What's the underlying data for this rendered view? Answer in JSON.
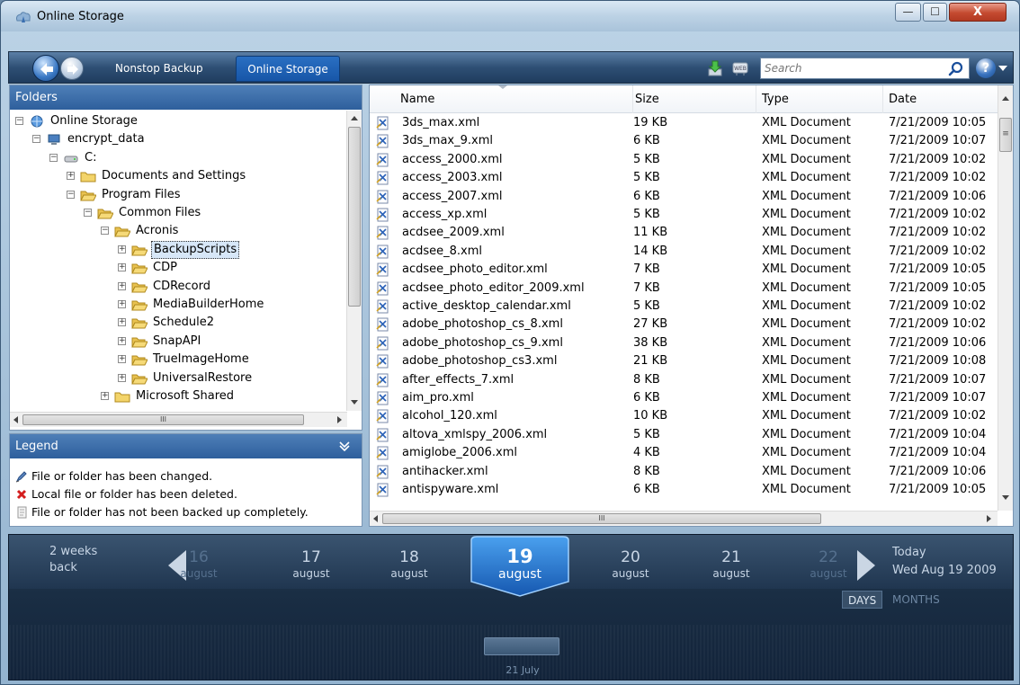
{
  "window": {
    "title": "Online Storage",
    "min_glyph": "—",
    "max_glyph": "☐",
    "close_glyph": "X"
  },
  "toolbar": {
    "tabs": [
      {
        "label": "Nonstop Backup"
      },
      {
        "label": "Online Storage"
      }
    ],
    "active_tab": "Online Storage",
    "search_placeholder": "Search",
    "help_glyph": "?"
  },
  "folders": {
    "title": "Folders",
    "tree": [
      {
        "label": "Online Storage",
        "expander": "−",
        "icon": "globe-icon"
      },
      {
        "label": "encrypt_data",
        "expander": "−",
        "icon": "computer-icon"
      },
      {
        "label": "C:",
        "expander": "−",
        "icon": "drive-icon"
      },
      {
        "label": "Documents and Settings",
        "expander": "+",
        "icon": "folder-icon"
      },
      {
        "label": "Program Files",
        "expander": "−",
        "icon": "open-folder-icon"
      },
      {
        "label": "Common Files",
        "expander": "−",
        "icon": "open-folder-icon"
      },
      {
        "label": "Acronis",
        "expander": "−",
        "icon": "open-folder-icon"
      },
      {
        "label": "BackupScripts",
        "expander": "+",
        "icon": "open-folder-icon",
        "selected": true
      },
      {
        "label": "CDP",
        "expander": "+",
        "icon": "open-folder-icon"
      },
      {
        "label": "CDRecord",
        "expander": "+",
        "icon": "open-folder-icon"
      },
      {
        "label": "MediaBuilderHome",
        "expander": "+",
        "icon": "open-folder-icon"
      },
      {
        "label": "Schedule2",
        "expander": "+",
        "icon": "open-folder-icon"
      },
      {
        "label": "SnapAPI",
        "expander": "+",
        "icon": "open-folder-icon"
      },
      {
        "label": "TrueImageHome",
        "expander": "+",
        "icon": "open-folder-icon"
      },
      {
        "label": "UniversalRestore",
        "expander": "+",
        "icon": "open-folder-icon"
      },
      {
        "label": "Microsoft Shared",
        "expander": "+",
        "icon": "folder-icon"
      }
    ],
    "hscroll_grip": "III"
  },
  "legend": {
    "title": "Legend",
    "items": [
      {
        "label": "File or folder has been changed.",
        "icon": "changed-file-icon"
      },
      {
        "label": "Local file or folder has been deleted.",
        "icon": "deleted-file-icon"
      },
      {
        "label": "File or folder has not been backed up completely.",
        "icon": "incomplete-file-icon"
      }
    ]
  },
  "files": {
    "columns": [
      "Name",
      "Size",
      "Type",
      "Date"
    ],
    "rows": [
      {
        "name": "3ds_max.xml",
        "size": "19 KB",
        "type": "XML Document",
        "date": "7/21/2009 10:05"
      },
      {
        "name": "3ds_max_9.xml",
        "size": "6 KB",
        "type": "XML Document",
        "date": "7/21/2009 10:07"
      },
      {
        "name": "access_2000.xml",
        "size": "5 KB",
        "type": "XML Document",
        "date": "7/21/2009 10:02"
      },
      {
        "name": "access_2003.xml",
        "size": "5 KB",
        "type": "XML Document",
        "date": "7/21/2009 10:02"
      },
      {
        "name": "access_2007.xml",
        "size": "6 KB",
        "type": "XML Document",
        "date": "7/21/2009 10:06"
      },
      {
        "name": "access_xp.xml",
        "size": "5 KB",
        "type": "XML Document",
        "date": "7/21/2009 10:02"
      },
      {
        "name": "acdsee_2009.xml",
        "size": "11 KB",
        "type": "XML Document",
        "date": "7/21/2009 10:02"
      },
      {
        "name": "acdsee_8.xml",
        "size": "14 KB",
        "type": "XML Document",
        "date": "7/21/2009 10:02"
      },
      {
        "name": "acdsee_photo_editor.xml",
        "size": "7 KB",
        "type": "XML Document",
        "date": "7/21/2009 10:05"
      },
      {
        "name": "acdsee_photo_editor_2009.xml",
        "size": "7 KB",
        "type": "XML Document",
        "date": "7/21/2009 10:05"
      },
      {
        "name": "active_desktop_calendar.xml",
        "size": "5 KB",
        "type": "XML Document",
        "date": "7/21/2009 10:02"
      },
      {
        "name": "adobe_photoshop_cs_8.xml",
        "size": "27 KB",
        "type": "XML Document",
        "date": "7/21/2009 10:02"
      },
      {
        "name": "adobe_photoshop_cs_9.xml",
        "size": "38 KB",
        "type": "XML Document",
        "date": "7/21/2009 10:06"
      },
      {
        "name": "adobe_photoshop_cs3.xml",
        "size": "21 KB",
        "type": "XML Document",
        "date": "7/21/2009 10:08"
      },
      {
        "name": "after_effects_7.xml",
        "size": "8 KB",
        "type": "XML Document",
        "date": "7/21/2009 10:07"
      },
      {
        "name": "aim_pro.xml",
        "size": "6 KB",
        "type": "XML Document",
        "date": "7/21/2009 10:07"
      },
      {
        "name": "alcohol_120.xml",
        "size": "10 KB",
        "type": "XML Document",
        "date": "7/21/2009 10:02"
      },
      {
        "name": "altova_xmlspy_2006.xml",
        "size": "5 KB",
        "type": "XML Document",
        "date": "7/21/2009 10:04"
      },
      {
        "name": "amiglobe_2006.xml",
        "size": "4 KB",
        "type": "XML Document",
        "date": "7/21/2009 10:04"
      },
      {
        "name": "antihacker.xml",
        "size": "8 KB",
        "type": "XML Document",
        "date": "7/21/2009 10:06"
      },
      {
        "name": "antispyware.xml",
        "size": "6 KB",
        "type": "XML Document",
        "date": "7/21/2009 10:05"
      }
    ],
    "vscroll_grip": "≡",
    "hscroll_grip": "III"
  },
  "timeline": {
    "back_label": "2 weeks\nback",
    "days": [
      {
        "num": "16",
        "month": "august",
        "dim": true
      },
      {
        "num": "17",
        "month": "august",
        "dim": false
      },
      {
        "num": "18",
        "month": "august",
        "dim": false
      },
      {
        "num": "19",
        "month": "august",
        "selected": true
      },
      {
        "num": "20",
        "month": "august",
        "dim": false
      },
      {
        "num": "21",
        "month": "august",
        "dim": false
      },
      {
        "num": "22",
        "month": "august",
        "dim": true
      }
    ],
    "today_label": "Today",
    "today_date": "Wed Aug 19 2009",
    "toggle": {
      "days": "DAYS",
      "months": "MONTHS"
    },
    "marker_label": "21 July"
  },
  "colors": {
    "accent": "#1756a8",
    "panel_header": "#3a6aa8",
    "timeline_bg": "#1a2e44"
  }
}
